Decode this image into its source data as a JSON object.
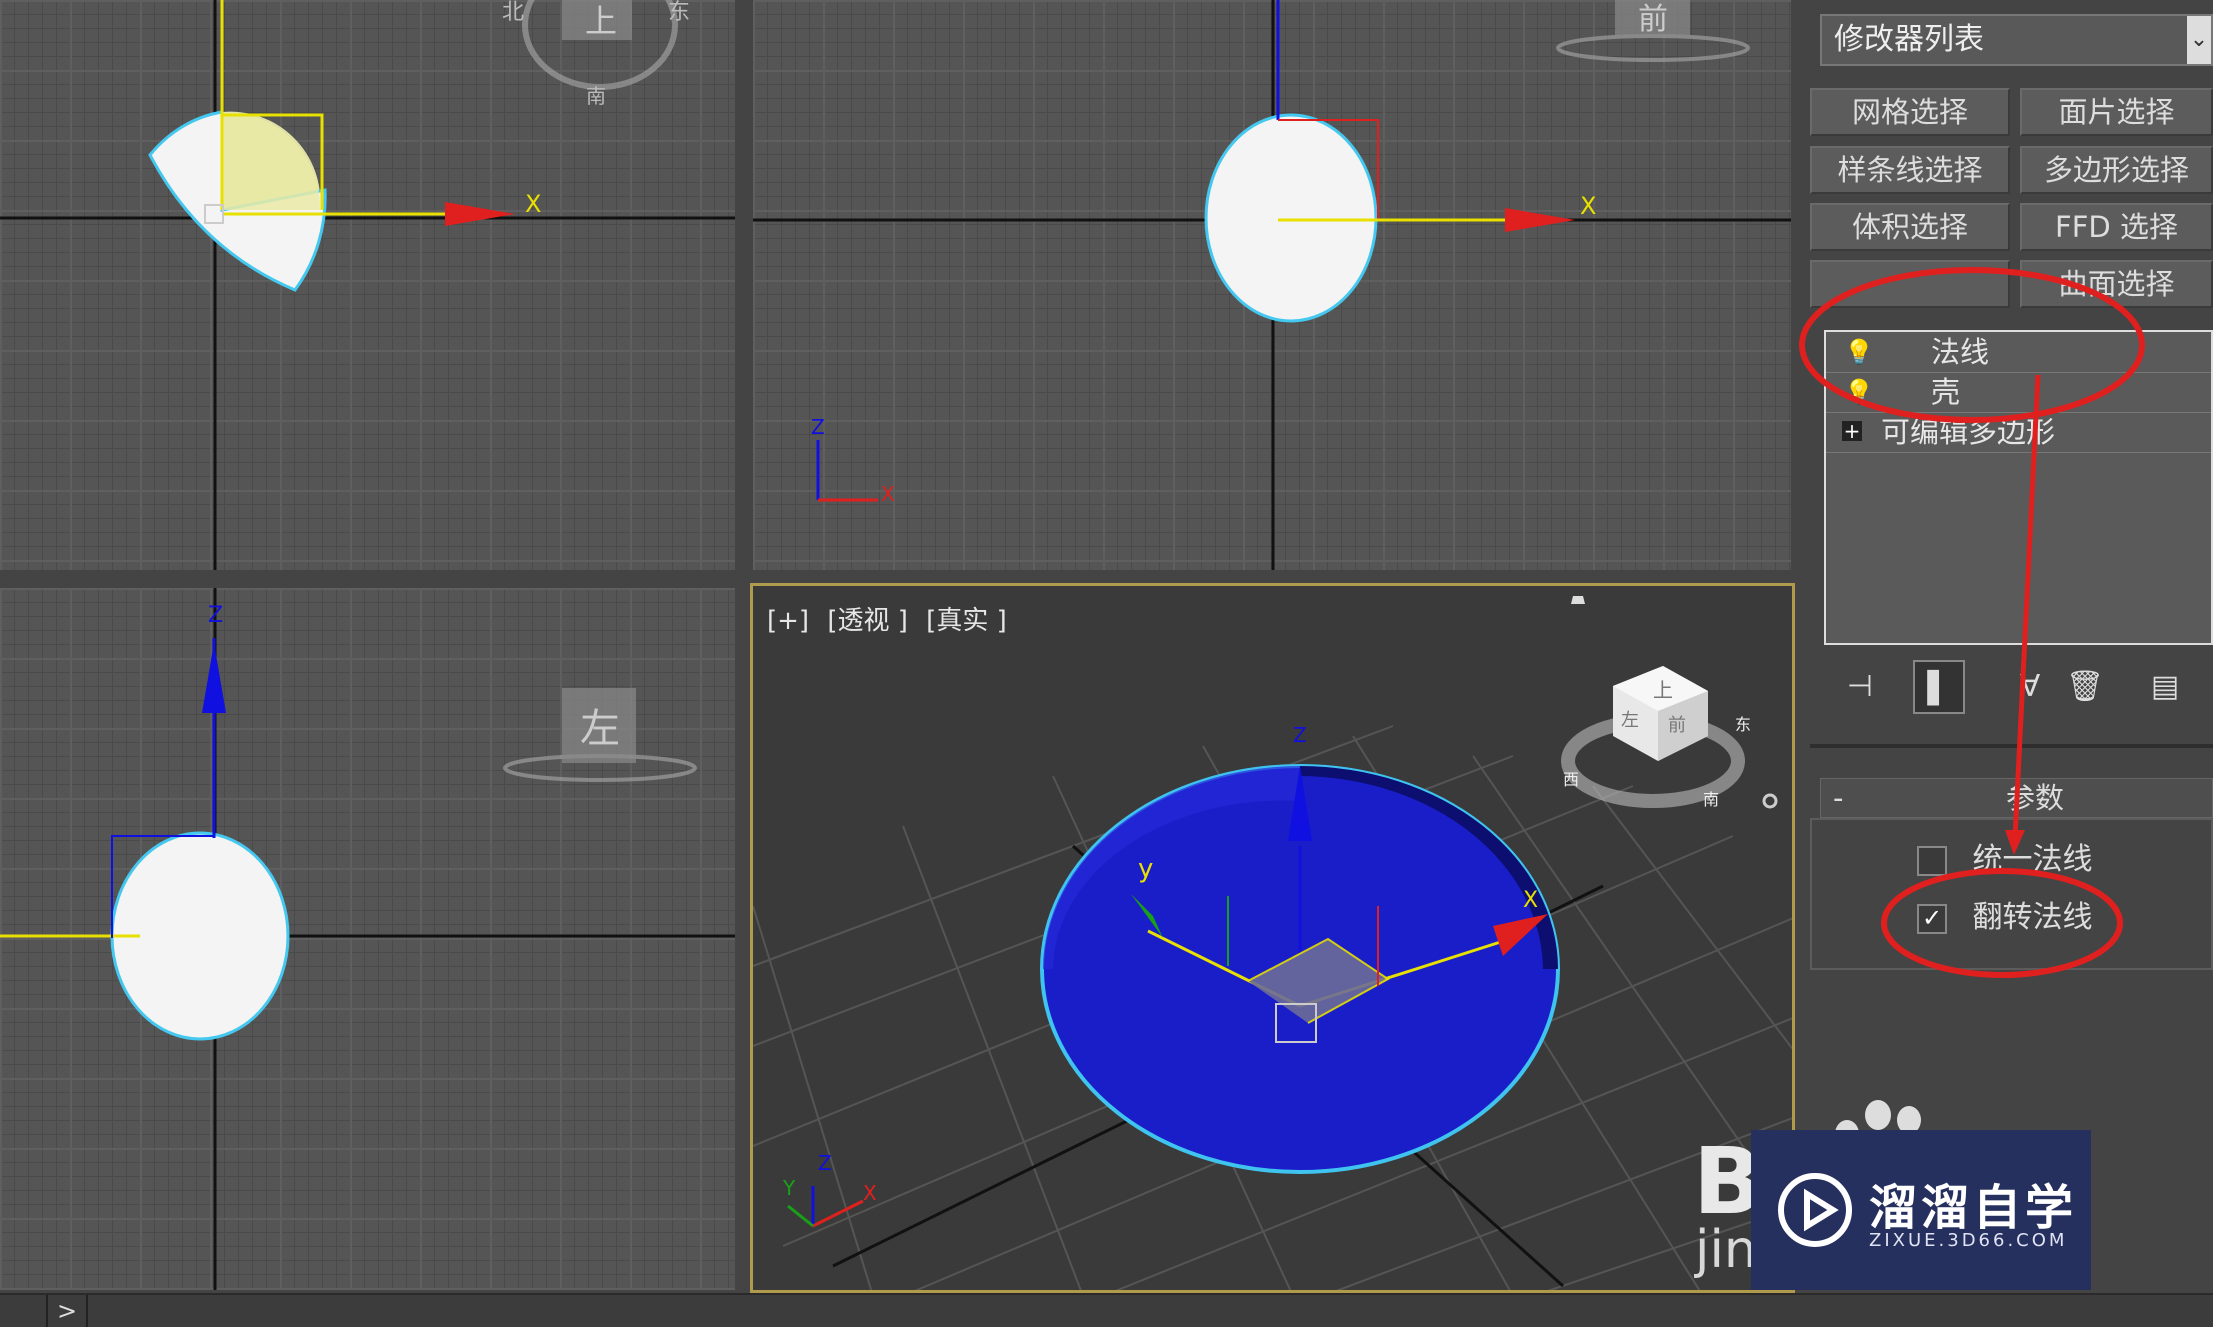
{
  "colors": {
    "accent_red": "#e0201e",
    "x_axis": "#e8e000",
    "z_axis": "#1010e0",
    "selection": "#3fc4f0",
    "persp_border": "#b09a4c",
    "shell_blue": "#1a1ec8"
  },
  "viewports": {
    "top": {
      "compass": {
        "n": "北",
        "s": "南",
        "e": "东",
        "label": "上"
      },
      "axis_x": "X"
    },
    "front": {
      "compass_label": "前",
      "axis_x": "X",
      "tripod": {
        "z": "Z",
        "x": "X"
      }
    },
    "left": {
      "compass_label": "左",
      "axis_z": "Z"
    },
    "perspective": {
      "label_plus": "[+]",
      "label_view": "[透视 ]",
      "label_shading": "[真实 ]",
      "gizmo": {
        "x": "X",
        "y": "y",
        "z": "Z"
      },
      "tripod": {
        "y": "Y",
        "z": "Z",
        "x": "X"
      },
      "viewcube": {
        "top": "上",
        "left": "左",
        "front": "前",
        "s": "南",
        "w": "西",
        "e": "东"
      }
    }
  },
  "panel": {
    "modifier_list": "修改器列表",
    "buttons": [
      "网格选择",
      "面片选择",
      "样条线选择",
      "多边形选择",
      "体积选择",
      "FFD 选择",
      "",
      "曲面选择"
    ],
    "stack": [
      {
        "icon": "lightbulb-icon",
        "label": "法线"
      },
      {
        "icon": "lightbulb-icon",
        "label": "壳"
      },
      {
        "icon": "expand-plus-icon",
        "label": "可编辑多边形"
      }
    ],
    "params": {
      "collapse": "-",
      "title": "参数",
      "unify": {
        "label": "统一法线",
        "checked": false
      },
      "flip": {
        "label": "翻转法线",
        "checked": true
      }
    }
  },
  "status": {
    "expand": ">"
  },
  "watermark": {
    "main": "溜溜自学",
    "sub": "ZIXUE.3D66.COM",
    "partial_brand": "B",
    "partial_sub": "jin"
  }
}
